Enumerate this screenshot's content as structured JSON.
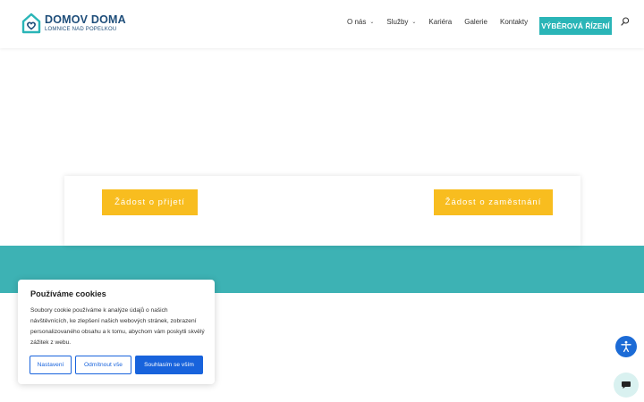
{
  "brand": {
    "name": "DOMOV DOMA",
    "subtitle": "LOMNICE NAD POPELKOU",
    "color_primary": "#1f4e7a",
    "color_accent": "#2ab5b7"
  },
  "nav": {
    "items": [
      {
        "label": "O nás",
        "has_dropdown": true
      },
      {
        "label": "Služby",
        "has_dropdown": true
      },
      {
        "label": "Kariéra",
        "has_dropdown": false
      },
      {
        "label": "Galerie",
        "has_dropdown": false
      },
      {
        "label": "Kontakty",
        "has_dropdown": false
      }
    ],
    "cta_label": "VÝBĚROVÁ ŘÍZENÍ",
    "search_icon": "search-icon",
    "dropdown_icon": "chevron-down-icon"
  },
  "actions": {
    "admission_label": "Žádost o přijetí",
    "employment_label": "Žádost o zaměstnání",
    "button_color": "#f8bd1f"
  },
  "band": {
    "color": "#3db2b4"
  },
  "cookie": {
    "title": "Používáme cookies",
    "text": "Soubory cookie používáme k analýze údajů o našich návštěvnících, ke zlepšení našich webových stránek, zobrazení personalizovaného obsahu a k tomu, abychom vám poskytli skvělý zážitek z webu.",
    "settings_label": "Nastavení",
    "reject_label": "Odmítnout vše",
    "accept_label": "Souhlasím se vším",
    "button_color": "#1863dc"
  },
  "floating": {
    "accessibility_icon": "accessibility-icon",
    "chat_icon": "chat-icon"
  }
}
